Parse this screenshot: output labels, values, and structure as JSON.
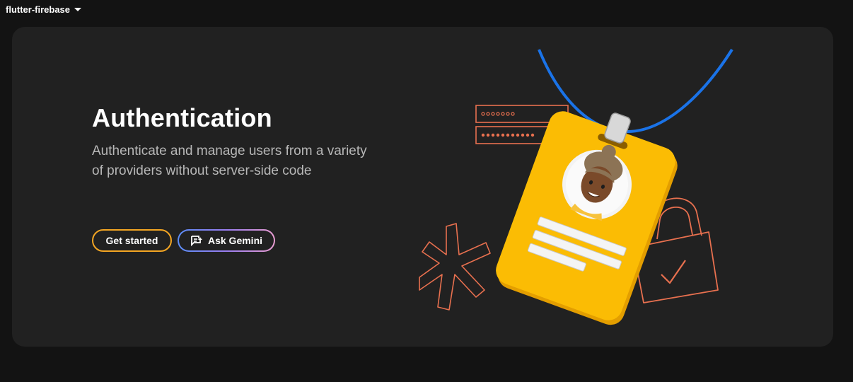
{
  "project": {
    "name": "flutter-firebase",
    "dropdown_icon": "caret-down-icon"
  },
  "hero": {
    "title": "Authentication",
    "description": "Authenticate and manage users from a variety of providers without server-side code",
    "buttons": {
      "get_started": "Get started",
      "ask_gemini": "Ask Gemini",
      "ask_gemini_icon": "gemini-chat-spark-icon"
    },
    "illustration": "id-badge-illustration"
  },
  "colors": {
    "background": "#131313",
    "card": "#212121",
    "accent_orange": "#f5a623",
    "badge_yellow": "#fbbc04",
    "lanyard_blue": "#1a73e8",
    "line_coral": "#e8704f"
  }
}
